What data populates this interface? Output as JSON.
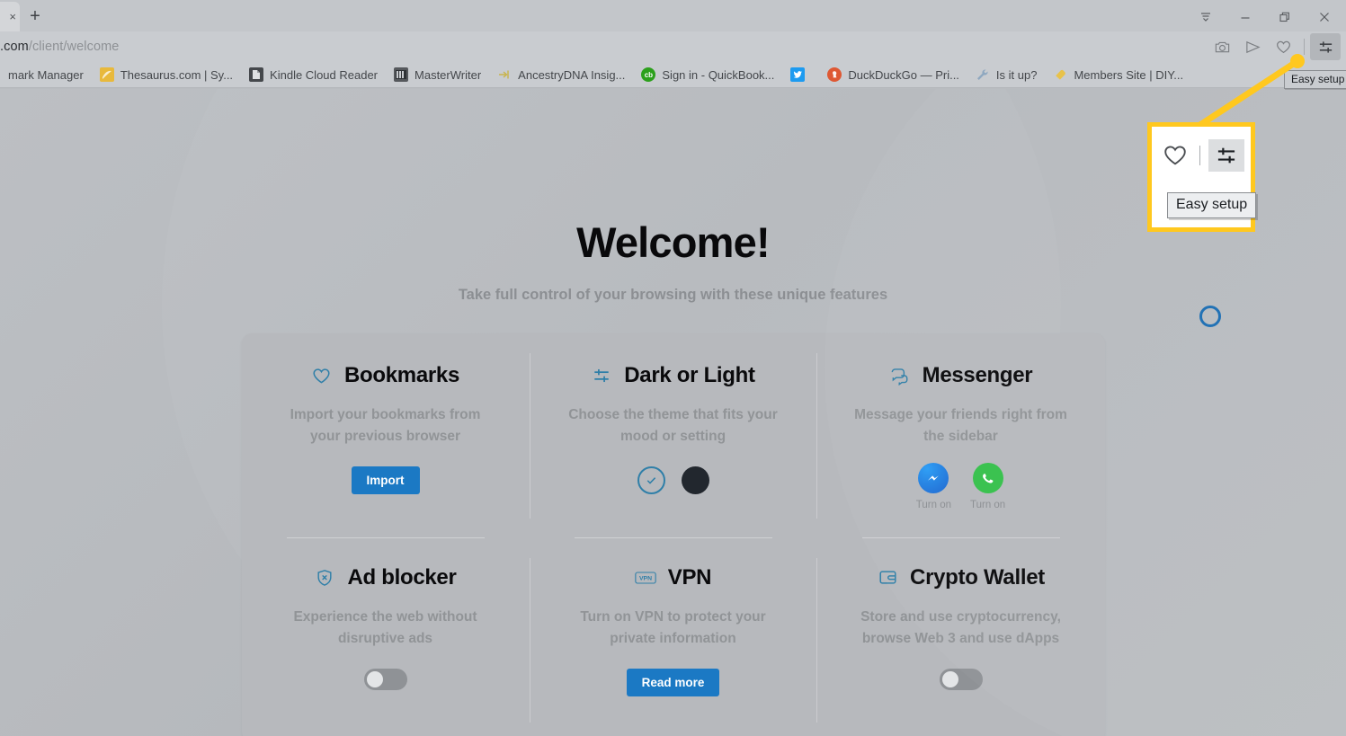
{
  "window": {
    "tab_close_glyph": "×",
    "new_tab_label": "+",
    "controls": [
      {
        "name": "tab-list-button",
        "label": "Tab list"
      },
      {
        "name": "minimize-button",
        "label": "Minimize"
      },
      {
        "name": "restore-button",
        "label": "Restore"
      },
      {
        "name": "close-button",
        "label": "Close"
      }
    ]
  },
  "address_bar": {
    "url_domain": ".com",
    "url_path": "/client/welcome",
    "icons": [
      {
        "name": "snapshot-icon",
        "label": "Snapshot"
      },
      {
        "name": "flow-send-icon",
        "label": "Flow"
      },
      {
        "name": "heart-bookmarks-icon",
        "label": "Bookmarks"
      },
      {
        "name": "easy-setup-icon",
        "label": "Easy setup"
      }
    ]
  },
  "bookmarks_bar": [
    {
      "label": "mark Manager",
      "icon": "folder-icon",
      "color": "#00000000"
    },
    {
      "label": "Thesaurus.com | Sy...",
      "icon": "thesaurus-icon",
      "color": "#e8b93c"
    },
    {
      "label": "Kindle Cloud Reader",
      "icon": "kindle-icon",
      "color": "#3f4246"
    },
    {
      "label": "MasterWriter",
      "icon": "masterwriter-icon",
      "color": "#6b6e72"
    },
    {
      "label": "AncestryDNA Insig...",
      "icon": "ancestry-icon",
      "color": "#d8c35a"
    },
    {
      "label": "Sign in - QuickBook...",
      "icon": "quickbooks-icon",
      "color": "#2ca01c"
    },
    {
      "label": "",
      "icon": "twitter-icon",
      "color": "#1d9bf0"
    },
    {
      "label": "DuckDuckGo — Pri...",
      "icon": "duckduckgo-icon",
      "color": "#de5833"
    },
    {
      "label": "Is it up?",
      "icon": "wrench-icon",
      "color": "#7f9cb5"
    },
    {
      "label": "Members Site | DIY...",
      "icon": "tag-icon",
      "color": "#e8c24a"
    }
  ],
  "welcome": {
    "title": "Welcome!",
    "subtitle": "Take full control of your browsing with these unique features"
  },
  "features": [
    {
      "id": "bookmarks",
      "icon": "heart-icon",
      "title": "Bookmarks",
      "description": "Import your bookmarks from your previous browser",
      "action_type": "button",
      "button_label": "Import"
    },
    {
      "id": "dark-or-light",
      "icon": "sliders-icon",
      "title": "Dark or Light",
      "description": "Choose the theme that fits your mood or setting",
      "action_type": "theme-swatches",
      "themes": [
        {
          "name": "light-theme-swatch",
          "selected": true,
          "color": "#b7b9bd"
        },
        {
          "name": "dark-theme-swatch",
          "selected": false,
          "color": "#22272e"
        }
      ]
    },
    {
      "id": "messenger",
      "icon": "chat-bubbles-icon",
      "title": "Messenger",
      "description": "Message your friends right from the sidebar",
      "action_type": "messenger-apps",
      "apps": [
        {
          "name": "facebook-messenger-icon",
          "label": "Turn on",
          "color": "#1e72d8"
        },
        {
          "name": "whatsapp-icon",
          "label": "Turn on",
          "color": "#35c14b"
        }
      ]
    },
    {
      "id": "ad-blocker",
      "icon": "shield-x-icon",
      "title": "Ad blocker",
      "description": "Experience the web without disruptive ads",
      "action_type": "toggle",
      "toggle_on": false
    },
    {
      "id": "vpn",
      "icon": "vpn-icon",
      "title": "VPN",
      "description": "Turn on VPN to protect your private information",
      "action_type": "button",
      "button_label": "Read more"
    },
    {
      "id": "crypto-wallet",
      "icon": "wallet-icon",
      "title": "Crypto Wallet",
      "description": "Store and use cryptocurrency, browse Web 3 and use dApps",
      "action_type": "toggle",
      "toggle_on": false
    }
  ],
  "annotation": {
    "highlight_color": "#ffc81f",
    "tooltip_label": "Easy setup",
    "browser_tooltip_label": "Easy setup"
  }
}
